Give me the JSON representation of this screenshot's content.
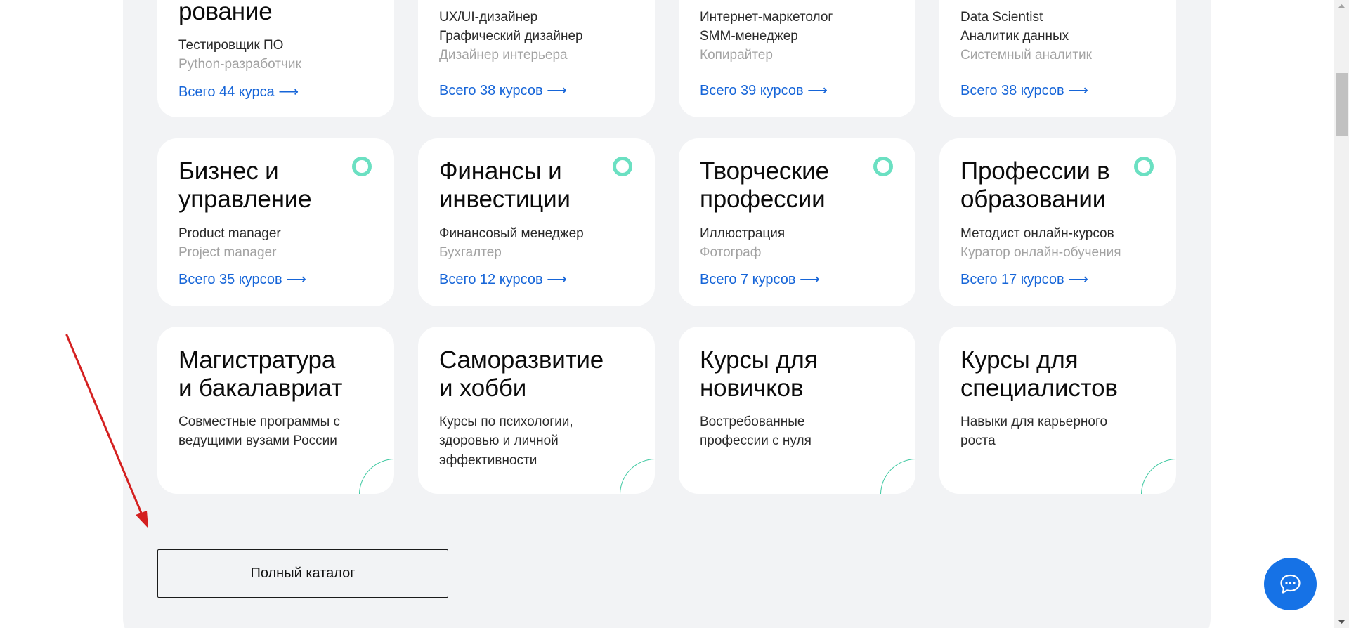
{
  "colors": {
    "panel_background": "#f2f3f5",
    "card_background": "#ffffff",
    "link": "#1665d8",
    "accent_ring": "#6be0c2",
    "chat_button": "#1672e6",
    "annotation_arrow": "#d42020"
  },
  "cards_row1": [
    {
      "title_tail": "рование",
      "items": [
        "Тестировщик ПО",
        "Python-разработчик"
      ],
      "link": "Всего 44 курса ⟶"
    },
    {
      "items": [
        "UX/UI-дизайнер",
        "Графический дизайнер",
        "Дизайнер интерьера"
      ],
      "link": "Всего 38 курсов ⟶"
    },
    {
      "items": [
        "Интернет-маркетолог",
        "SMM-менеджер",
        "Копирайтер"
      ],
      "link": "Всего 39 курсов ⟶"
    },
    {
      "items": [
        "Data Scientist",
        "Аналитик данных",
        "Системный аналитик"
      ],
      "link": "Всего 38 курсов ⟶"
    }
  ],
  "cards_row2": [
    {
      "title_lines": [
        "Бизнес и",
        "управление"
      ],
      "items": [
        "Product manager",
        "Project manager"
      ],
      "link": "Всего 35 курсов ⟶",
      "icon": "ring-icon"
    },
    {
      "title_lines": [
        "Финансы и",
        "инвестиции"
      ],
      "items": [
        "Финансовый менеджер",
        "Бухгалтер"
      ],
      "link": "Всего 12 курсов ⟶",
      "icon": "ring-icon"
    },
    {
      "title_lines": [
        "Творческие",
        "профессии"
      ],
      "items": [
        "Иллюстрация",
        "Фотограф"
      ],
      "link": "Всего 7 курсов ⟶",
      "icon": "ring-icon"
    },
    {
      "title_lines": [
        "Профессии в",
        "образовании"
      ],
      "items": [
        "Методист онлайн-курсов",
        "Куратор онлайн-обучения"
      ],
      "link": "Всего 17 курсов ⟶",
      "icon": "ring-icon"
    }
  ],
  "cards_row3": [
    {
      "title_lines": [
        "Магистратура",
        "и бакалавриат"
      ],
      "desc_lines": [
        "Совместные программы с",
        "ведущими вузами России"
      ]
    },
    {
      "title_lines": [
        "Саморазвитие",
        "и хобби"
      ],
      "desc_lines": [
        "Курсы по психологии,",
        "здоровью и личной",
        "эффективности"
      ]
    },
    {
      "title_lines": [
        "Курсы для",
        "новичков"
      ],
      "desc_lines": [
        "Востребованные",
        "профессии с нуля"
      ]
    },
    {
      "title_lines": [
        "Курсы для",
        "специалистов"
      ],
      "desc_lines": [
        "Навыки для карьерного",
        "роста"
      ]
    }
  ],
  "catalog_button": {
    "label": "Полный каталог"
  },
  "chat_button": {
    "icon": "chat-bubble-icon"
  }
}
